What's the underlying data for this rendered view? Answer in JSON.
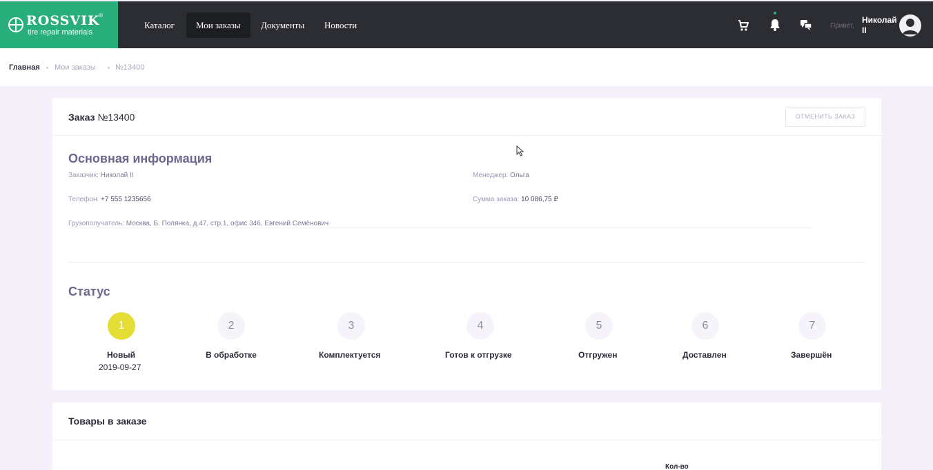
{
  "brand": {
    "name": "ROSSVIK",
    "reg": "®",
    "tagline": "tire repair materials",
    "color": "#27ae7a"
  },
  "nav": [
    {
      "label": "Каталог",
      "active": false
    },
    {
      "label": "Мои заказы",
      "active": true
    },
    {
      "label": "Документы",
      "active": false
    },
    {
      "label": "Новости",
      "active": false
    }
  ],
  "header": {
    "icons": [
      "cart-icon",
      "bell-icon",
      "chat-icon"
    ],
    "greeting": "Привет,",
    "user_name": "Николай II"
  },
  "breadcrumbs": [
    "Главная",
    "Мои заказы",
    "№13400"
  ],
  "order": {
    "title_prefix": "Заказ",
    "title_number": "№13400",
    "cancel_label": "ОТМЕНИТЬ ЗАКАЗ",
    "main_info_title": "Основная информация",
    "customer_label": "Заказчик:",
    "customer_value": "Николай II",
    "manager_label": "Менеджер:",
    "manager_value": "Ольга",
    "phone_label": "Телефон:",
    "phone_value": "+7 555 1235656",
    "total_label": "Сумма заказа:",
    "total_value": "10 086,75 ₽",
    "consignee_label": "Грузополучатель:",
    "consignee_value": "Москва, Б. Полянка, д.47, стр.1, офис 346, Евгений Семёнович",
    "status_title": "Статус",
    "steps": [
      {
        "num": "1",
        "label": "Новый",
        "date": "2019-09-27",
        "active": true
      },
      {
        "num": "2",
        "label": "В обработке"
      },
      {
        "num": "3",
        "label": "Комплектуется"
      },
      {
        "num": "4",
        "label": "Готов к отгрузке"
      },
      {
        "num": "5",
        "label": "Отгружен"
      },
      {
        "num": "6",
        "label": "Доставлен"
      },
      {
        "num": "7",
        "label": "Завершён"
      }
    ],
    "active_color": "#e3dd35"
  },
  "goods": {
    "title": "Товары в заказе",
    "qty_header": "Кол-во"
  }
}
